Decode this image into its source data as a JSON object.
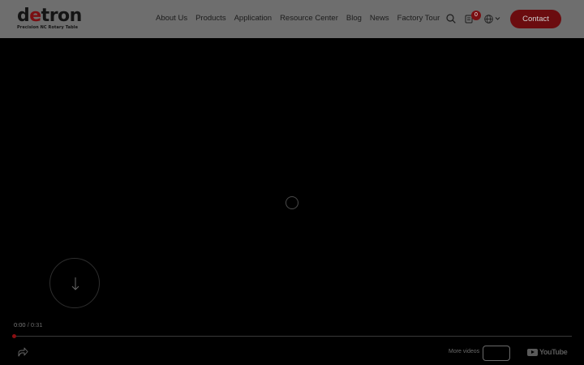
{
  "brand": {
    "logo_prefix": "d",
    "logo_accent": "e",
    "logo_rest": "tron",
    "tagline": "Precision NC Rotary Table",
    "accent_color": "#7a0f12"
  },
  "nav": {
    "items": [
      {
        "label": "About Us"
      },
      {
        "label": "Products"
      },
      {
        "label": "Application"
      },
      {
        "label": "Resource Center"
      },
      {
        "label": "Blog"
      },
      {
        "label": "News"
      },
      {
        "label": "Factory Tour"
      }
    ]
  },
  "header": {
    "cart_count": "0",
    "contact_label": "Contact",
    "icons": [
      "search-icon",
      "cart-icon",
      "globe-icon",
      "chevron-down-icon"
    ]
  },
  "player": {
    "current_time": "0:00",
    "separator": " / ",
    "duration": "0:31",
    "progress": 0.0,
    "more_videos_label": "More videos",
    "youtube_label": "YouTube"
  }
}
